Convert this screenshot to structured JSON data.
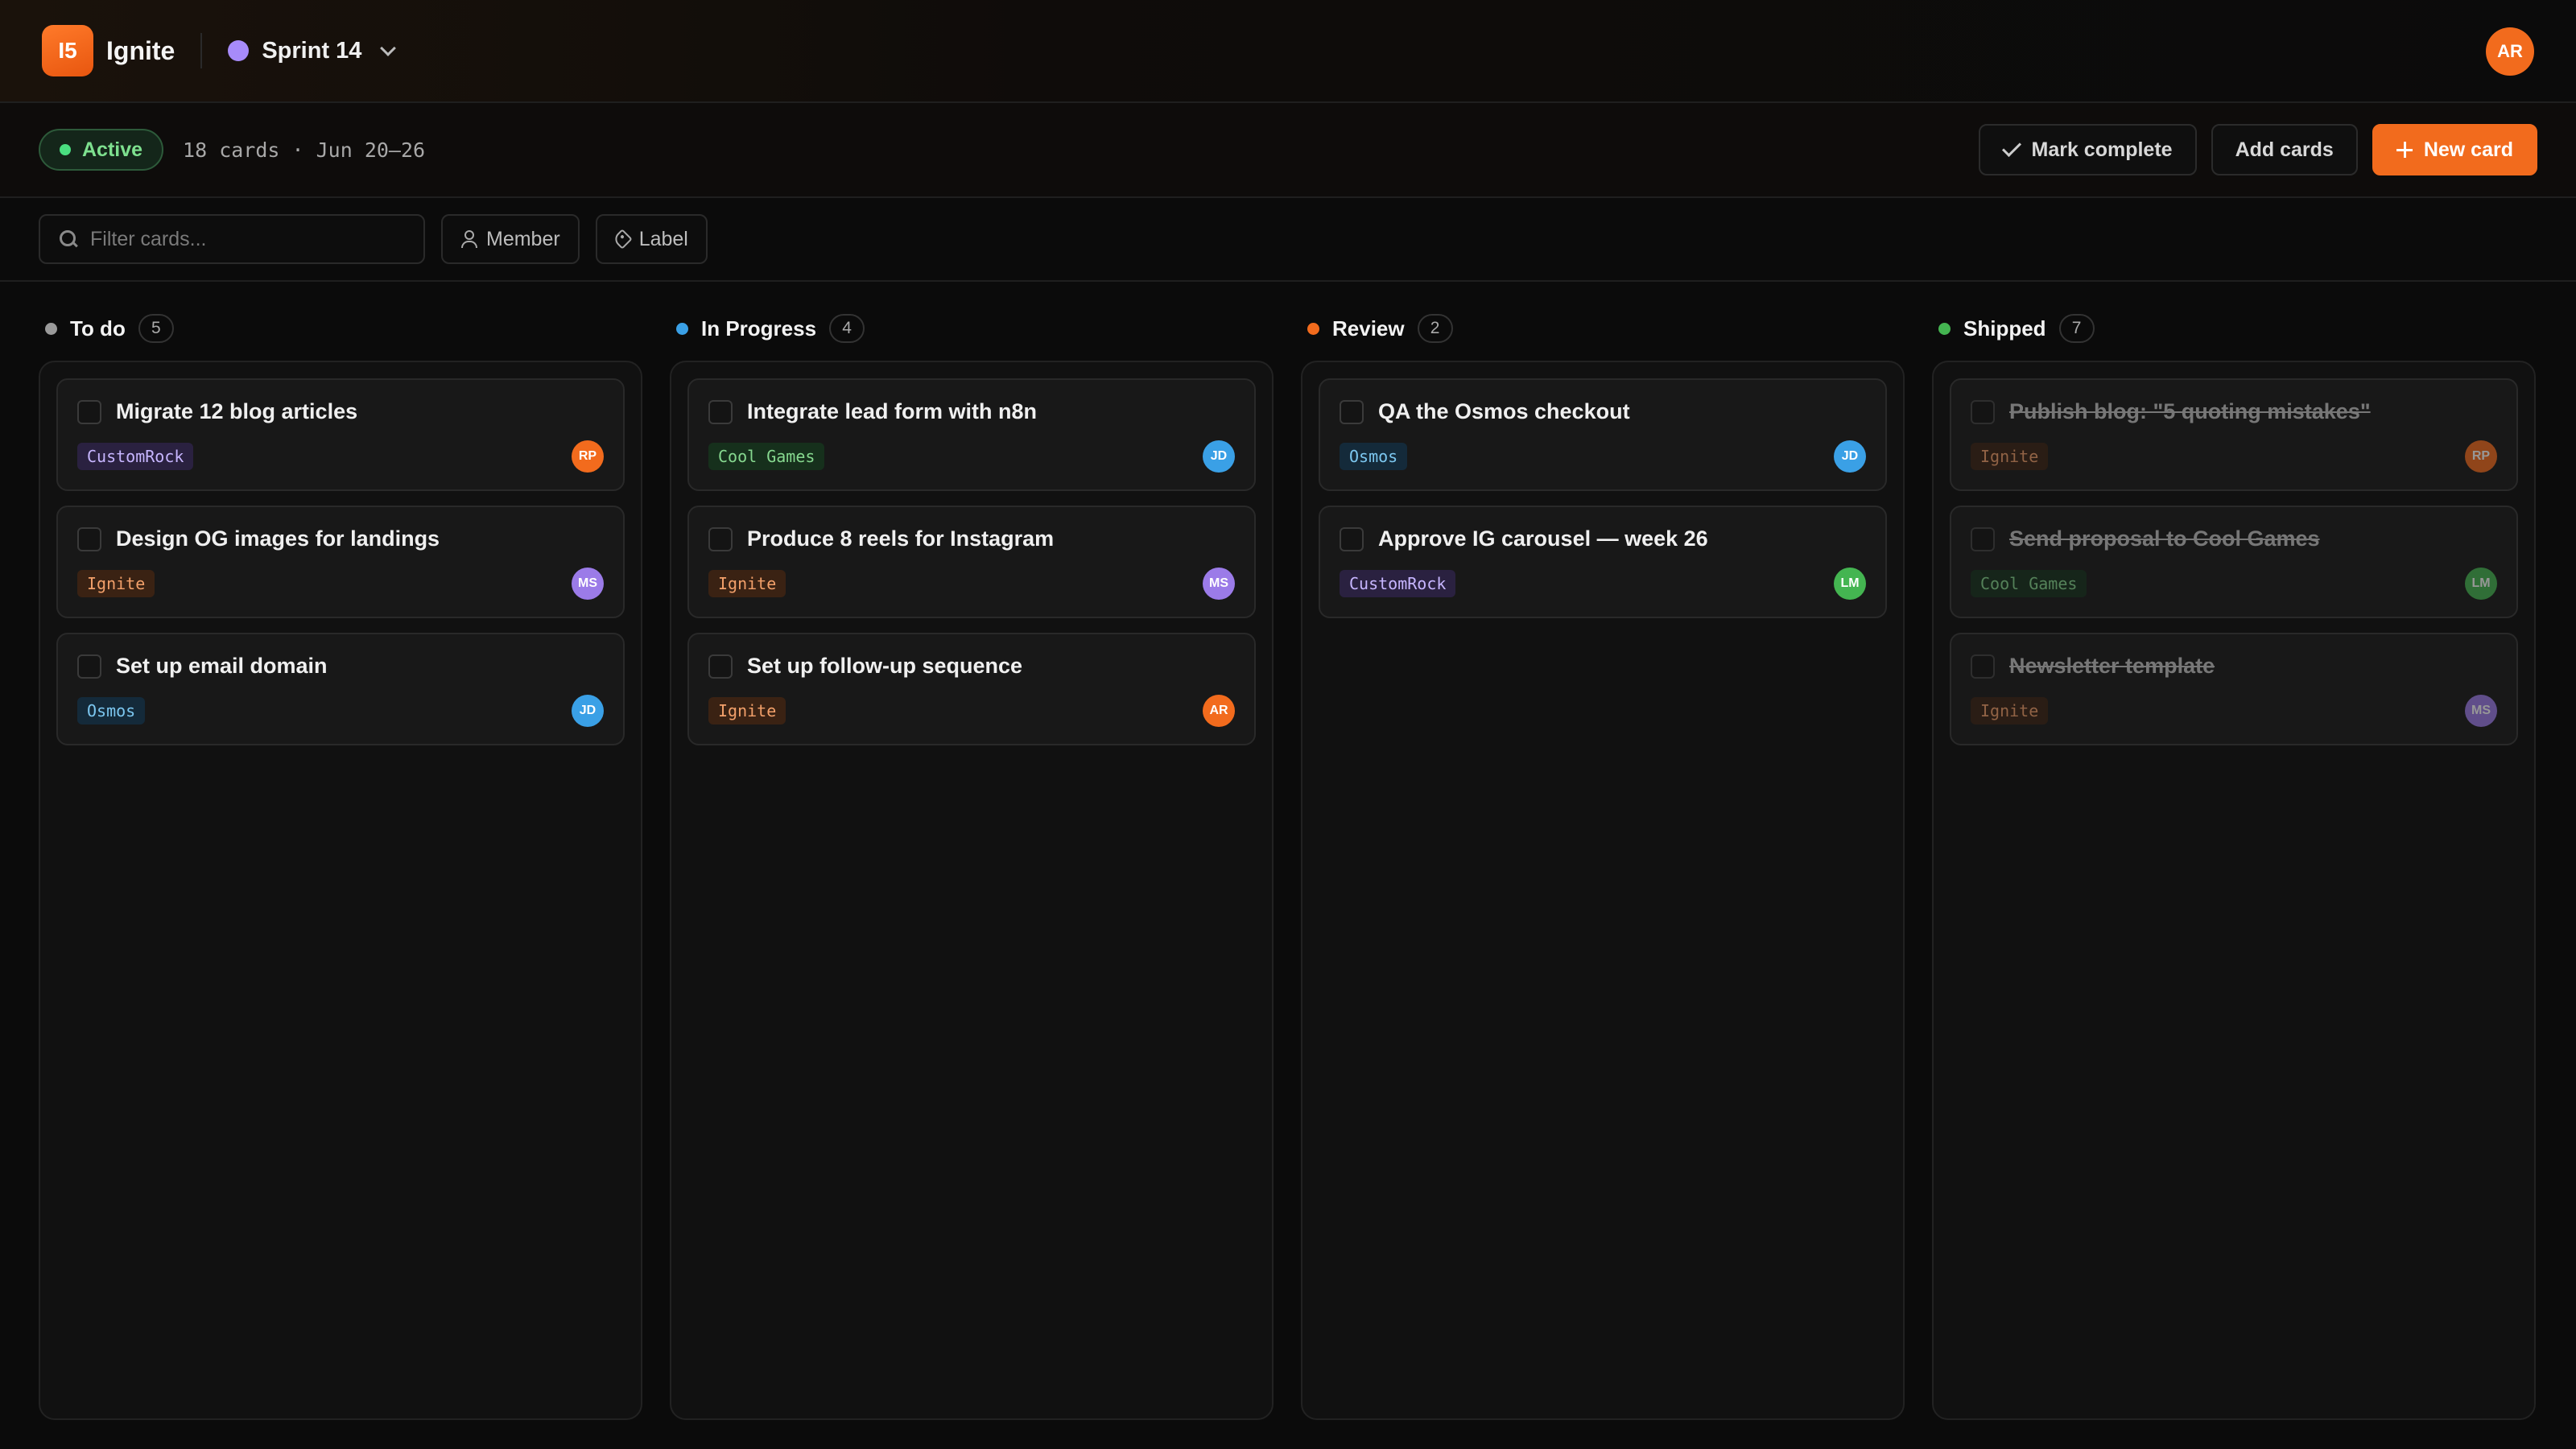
{
  "app": {
    "logo_text": "I5",
    "title": "Ignite",
    "sprint_name": "Sprint 14",
    "sprint_color": "#a78bfa",
    "user_avatar": "AR",
    "accent": "#f26b1d"
  },
  "sprint_info": {
    "status": "Active",
    "meta": "18 cards · Jun 20–26",
    "actions": {
      "mark_complete": "Mark complete",
      "add_cards": "Add cards",
      "new_card": "New card"
    }
  },
  "filters": {
    "search_placeholder": "Filter cards...",
    "member": "Member",
    "label": "Label"
  },
  "columns": [
    {
      "name": "To do",
      "count": "5",
      "color": "#9a9a9a",
      "cards": [
        {
          "title": "Migrate 12 blog articles",
          "label": "CustomRock",
          "assignee": "RP"
        },
        {
          "title": "Design OG images for landings",
          "label": "Ignite",
          "assignee": "MS"
        },
        {
          "title": "Set up email domain",
          "label": "Osmos",
          "assignee": "JD"
        }
      ]
    },
    {
      "name": "In Progress",
      "count": "4",
      "color": "#3aa0e6",
      "cards": [
        {
          "title": "Integrate lead form with n8n",
          "label": "Cool Games",
          "assignee": "JD"
        },
        {
          "title": "Produce 8 reels for Instagram",
          "label": "Ignite",
          "assignee": "MS"
        },
        {
          "title": "Set up follow-up sequence",
          "label": "Ignite",
          "assignee": "AR"
        }
      ]
    },
    {
      "name": "Review",
      "count": "2",
      "color": "#f26b1d",
      "cards": [
        {
          "title": "QA the Osmos checkout",
          "label": "Osmos",
          "assignee": "JD"
        },
        {
          "title": "Approve IG carousel — week 26",
          "label": "CustomRock",
          "assignee": "LM"
        }
      ]
    },
    {
      "name": "Shipped",
      "count": "7",
      "color": "#44b551",
      "cards": [
        {
          "title": "Publish blog: \"5 quoting mistakes\"",
          "label": "Ignite",
          "assignee": "RP"
        },
        {
          "title": "Send proposal to Cool Games",
          "label": "Cool Games",
          "assignee": "LM"
        },
        {
          "title": "Newsletter template",
          "label": "Ignite",
          "assignee": "MS"
        }
      ]
    }
  ]
}
